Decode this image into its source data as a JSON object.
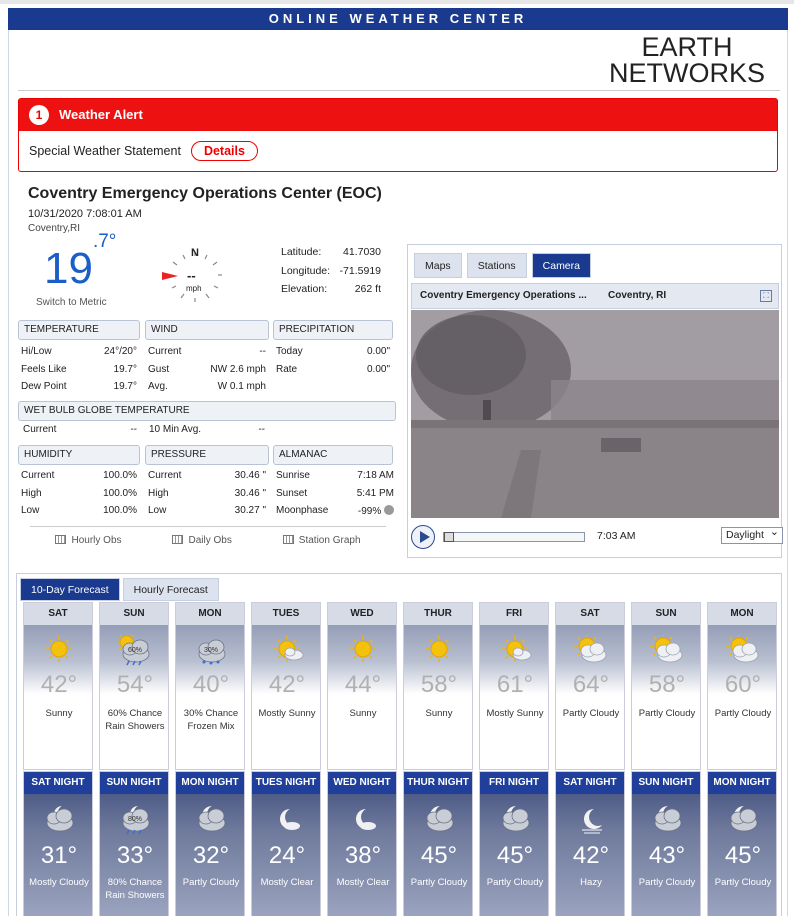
{
  "header": {
    "title": "ONLINE WEATHER CENTER"
  },
  "logo": {
    "line1": "EARTH",
    "line2": "NETWORKS"
  },
  "alert": {
    "count": "1",
    "title": "Weather Alert",
    "message": "Special Weather Statement",
    "details_label": "Details"
  },
  "station": {
    "name": "Coventry Emergency Operations Center (EOC)",
    "datetime": "10/31/2020 7:08:01 AM",
    "location": "Coventry,RI",
    "temp_main": "19",
    "temp_decimal": ".7°",
    "switch_label": "Switch to Metric",
    "wind_speed": "--",
    "wind_unit": "mph",
    "compass_n": "N"
  },
  "coords": [
    {
      "label": "Latitude:",
      "value": "41.7030"
    },
    {
      "label": "Longitude:",
      "value": "-71.5919"
    },
    {
      "label": "Elevation:",
      "value": "262 ft"
    }
  ],
  "temperature": {
    "title": "TEMPERATURE",
    "rows": [
      {
        "label": "Hi/Low",
        "value": "24°/20°"
      },
      {
        "label": "Feels Like",
        "value": "19.7°"
      },
      {
        "label": "Dew Point",
        "value": "19.7°"
      }
    ]
  },
  "wind": {
    "title": "WIND",
    "rows": [
      {
        "label": "Current",
        "value": "--"
      },
      {
        "label": "Gust",
        "value": "NW 2.6 mph"
      },
      {
        "label": "Avg.",
        "value": "W 0.1 mph"
      }
    ]
  },
  "precipitation": {
    "title": "PRECIPITATION",
    "rows": [
      {
        "label": "Today",
        "value": "0.00\""
      },
      {
        "label": "Rate",
        "value": "0.00\""
      }
    ]
  },
  "wbgt": {
    "title": "WET BULB GLOBE TEMPERATURE",
    "rows": [
      {
        "label": "Current",
        "value": "--"
      },
      {
        "label": "10 Min Avg.",
        "value": "--"
      }
    ]
  },
  "humidity": {
    "title": "HUMIDITY",
    "rows": [
      {
        "label": "Current",
        "value": "100.0%"
      },
      {
        "label": "High",
        "value": "100.0%"
      },
      {
        "label": "Low",
        "value": "100.0%"
      }
    ]
  },
  "pressure": {
    "title": "PRESSURE",
    "rows": [
      {
        "label": "Current",
        "value": "30.46 \""
      },
      {
        "label": "High",
        "value": "30.46 \""
      },
      {
        "label": "Low",
        "value": "30.27 \""
      }
    ]
  },
  "almanac": {
    "title": "ALMANAC",
    "rows": [
      {
        "label": "Sunrise",
        "value": "7:18 AM"
      },
      {
        "label": "Sunset",
        "value": "5:41 PM"
      },
      {
        "label": "Moonphase",
        "value": "-99%"
      }
    ]
  },
  "obs_links": [
    "Hourly Obs",
    "Daily Obs",
    "Station Graph"
  ],
  "camera": {
    "tabs": [
      "Maps",
      "Stations",
      "Camera"
    ],
    "active_tab": "Camera",
    "bar_title": "Coventry Emergency Operations ...",
    "bar_location": "Coventry, RI",
    "time": "7:03 AM",
    "mode": "Daylight"
  },
  "forecast": {
    "tabs": [
      "10-Day Forecast",
      "Hourly Forecast"
    ],
    "active_tab": "10-Day Forecast",
    "days": [
      {
        "name": "SAT",
        "temp": "42°",
        "desc": "Sunny",
        "icon": "sun-icon"
      },
      {
        "name": "SUN",
        "temp": "54°",
        "desc": "60% Chance Rain Showers",
        "icon": "rain-showers-icon",
        "pct": "60%"
      },
      {
        "name": "MON",
        "temp": "40°",
        "desc": "30% Chance Frozen Mix",
        "icon": "frozen-mix-icon",
        "pct": "30%"
      },
      {
        "name": "TUES",
        "temp": "42°",
        "desc": "Mostly Sunny",
        "icon": "mostly-sunny-icon"
      },
      {
        "name": "WED",
        "temp": "44°",
        "desc": "Sunny",
        "icon": "sun-icon"
      },
      {
        "name": "THUR",
        "temp": "58°",
        "desc": "Sunny",
        "icon": "sun-icon"
      },
      {
        "name": "FRI",
        "temp": "61°",
        "desc": "Mostly Sunny",
        "icon": "mostly-sunny-icon"
      },
      {
        "name": "SAT",
        "temp": "64°",
        "desc": "Partly Cloudy",
        "icon": "partly-cloudy-icon"
      },
      {
        "name": "SUN",
        "temp": "58°",
        "desc": "Partly Cloudy",
        "icon": "partly-cloudy-icon"
      },
      {
        "name": "MON",
        "temp": "60°",
        "desc": "Partly Cloudy",
        "icon": "partly-cloudy-icon"
      }
    ],
    "nights": [
      {
        "name": "SAT NIGHT",
        "temp": "31°",
        "desc": "Mostly Cloudy",
        "icon": "mostly-cloudy-night-icon"
      },
      {
        "name": "SUN NIGHT",
        "temp": "33°",
        "desc": "80% Chance Rain Showers",
        "icon": "rain-showers-night-icon",
        "pct": "80%"
      },
      {
        "name": "MON NIGHT",
        "temp": "32°",
        "desc": "Partly Cloudy",
        "icon": "partly-cloudy-night-icon"
      },
      {
        "name": "TUES NIGHT",
        "temp": "24°",
        "desc": "Mostly Clear",
        "icon": "mostly-clear-night-icon"
      },
      {
        "name": "WED NIGHT",
        "temp": "38°",
        "desc": "Mostly Clear",
        "icon": "mostly-clear-night-icon"
      },
      {
        "name": "THUR NIGHT",
        "temp": "45°",
        "desc": "Partly Cloudy",
        "icon": "partly-cloudy-night-icon"
      },
      {
        "name": "FRI NIGHT",
        "temp": "45°",
        "desc": "Partly Cloudy",
        "icon": "partly-cloudy-night-icon"
      },
      {
        "name": "SAT NIGHT",
        "temp": "42°",
        "desc": "Hazy",
        "icon": "hazy-night-icon"
      },
      {
        "name": "SUN NIGHT",
        "temp": "43°",
        "desc": "Partly Cloudy",
        "icon": "partly-cloudy-night-icon"
      },
      {
        "name": "MON NIGHT",
        "temp": "45°",
        "desc": "Partly Cloudy",
        "icon": "partly-cloudy-night-icon"
      }
    ]
  },
  "colors": {
    "brand_blue": "#1a3a8f",
    "alert_red": "#ee1111",
    "temp_blue": "#1a5fc7"
  }
}
